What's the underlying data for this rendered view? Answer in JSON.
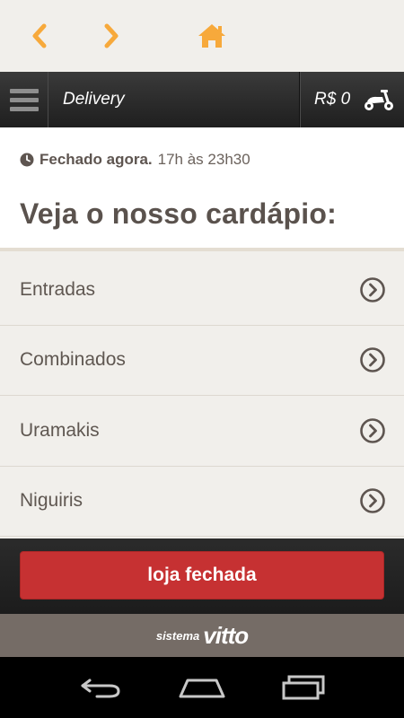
{
  "colors": {
    "accent": "#f7a93b",
    "header_bg": "#2a2a2a",
    "closed_button": "#c63132",
    "brand_bar": "#756c66",
    "text_primary": "#5a524d"
  },
  "topnav": {
    "back_icon": "chevron-left-icon",
    "forward_icon": "chevron-right-icon",
    "home_icon": "home-icon"
  },
  "header": {
    "menu_icon": "hamburger-menu-icon",
    "title": "Delivery",
    "cart_total": "R$ 0",
    "cart_icon": "scooter-icon"
  },
  "info": {
    "status_icon": "clock-icon",
    "status_closed": "Fechado agora.",
    "hours": "17h às 23h30",
    "heading": "Veja o nosso cardápio:"
  },
  "menu": {
    "items": [
      {
        "label": "Entradas"
      },
      {
        "label": "Combinados"
      },
      {
        "label": "Uramakis"
      },
      {
        "label": "Niguiris"
      }
    ]
  },
  "footer": {
    "button_label": "loja fechada"
  },
  "brand": {
    "prefix": "sistema",
    "name": "vitto"
  },
  "system_nav": {
    "back_icon": "android-back-icon",
    "home_icon": "android-home-icon",
    "recents_icon": "android-recents-icon"
  }
}
